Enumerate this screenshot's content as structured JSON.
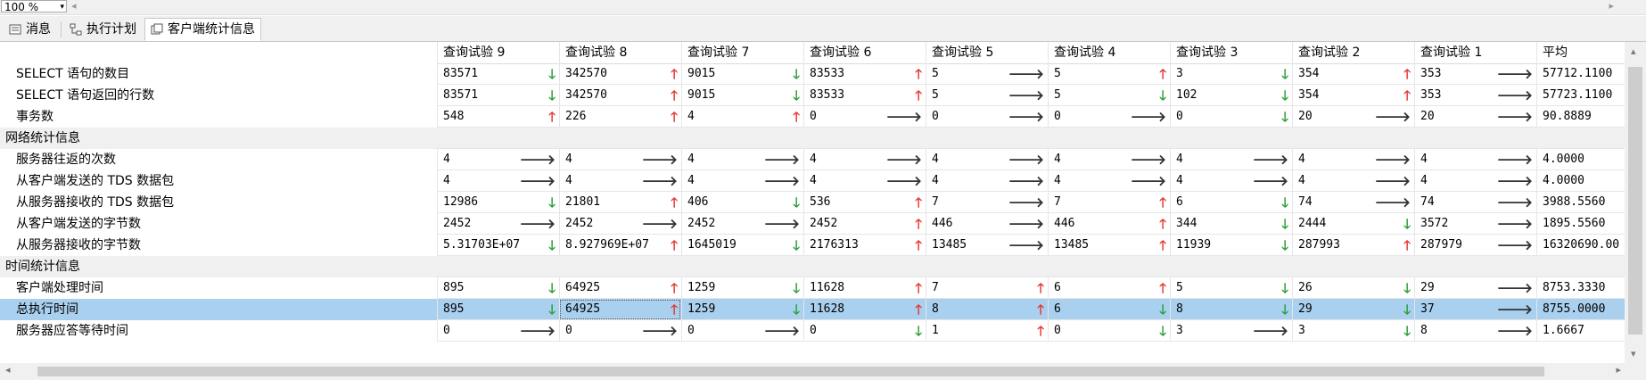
{
  "toolbar": {
    "zoom": "100 %"
  },
  "tabs": [
    {
      "label": "消息",
      "icon": "messages-icon"
    },
    {
      "label": "执行计划",
      "icon": "execution-plan-icon"
    },
    {
      "label": "客户端统计信息",
      "icon": "client-stats-icon"
    }
  ],
  "columns": [
    "查询试验 9",
    "查询试验 8",
    "查询试验 7",
    "查询试验 6",
    "查询试验 5",
    "查询试验 4",
    "查询试验 3",
    "查询试验 2",
    "查询试验 1",
    "平均"
  ],
  "rows": [
    {
      "label": "SELECT 语句的数目",
      "section": false,
      "cells": [
        [
          "83571",
          "down"
        ],
        [
          "342570",
          "up"
        ],
        [
          "9015",
          "down"
        ],
        [
          "83533",
          "up"
        ],
        [
          "5",
          "flat"
        ],
        [
          "5",
          "up"
        ],
        [
          "3",
          "down"
        ],
        [
          "354",
          "up"
        ],
        [
          "353",
          "flat"
        ]
      ],
      "avg": "57712.1100"
    },
    {
      "label": "SELECT 语句返回的行数",
      "section": false,
      "cells": [
        [
          "83571",
          "down"
        ],
        [
          "342570",
          "up"
        ],
        [
          "9015",
          "down"
        ],
        [
          "83533",
          "up"
        ],
        [
          "5",
          "flat"
        ],
        [
          "5",
          "down"
        ],
        [
          "102",
          "down"
        ],
        [
          "354",
          "up"
        ],
        [
          "353",
          "flat"
        ]
      ],
      "avg": "57723.1100"
    },
    {
      "label": "事务数",
      "section": false,
      "cells": [
        [
          "548",
          "up"
        ],
        [
          "226",
          "up"
        ],
        [
          "4",
          "up"
        ],
        [
          "0",
          "flat"
        ],
        [
          "0",
          "flat"
        ],
        [
          "0",
          "flat"
        ],
        [
          "0",
          "down"
        ],
        [
          "20",
          "flat"
        ],
        [
          "20",
          "flat"
        ]
      ],
      "avg": "90.8889"
    },
    {
      "label": "网络统计信息",
      "section": true
    },
    {
      "label": "服务器往返的次数",
      "section": false,
      "cells": [
        [
          "4",
          "flat"
        ],
        [
          "4",
          "flat"
        ],
        [
          "4",
          "flat"
        ],
        [
          "4",
          "flat"
        ],
        [
          "4",
          "flat"
        ],
        [
          "4",
          "flat"
        ],
        [
          "4",
          "flat"
        ],
        [
          "4",
          "flat"
        ],
        [
          "4",
          "flat"
        ]
      ],
      "avg": "4.0000"
    },
    {
      "label": "从客户端发送的 TDS 数据包",
      "section": false,
      "cells": [
        [
          "4",
          "flat"
        ],
        [
          "4",
          "flat"
        ],
        [
          "4",
          "flat"
        ],
        [
          "4",
          "flat"
        ],
        [
          "4",
          "flat"
        ],
        [
          "4",
          "flat"
        ],
        [
          "4",
          "flat"
        ],
        [
          "4",
          "flat"
        ],
        [
          "4",
          "flat"
        ]
      ],
      "avg": "4.0000"
    },
    {
      "label": "从服务器接收的 TDS 数据包",
      "section": false,
      "cells": [
        [
          "12986",
          "down"
        ],
        [
          "21801",
          "up"
        ],
        [
          "406",
          "down"
        ],
        [
          "536",
          "up"
        ],
        [
          "7",
          "flat"
        ],
        [
          "7",
          "up"
        ],
        [
          "6",
          "down"
        ],
        [
          "74",
          "flat"
        ],
        [
          "74",
          "flat"
        ]
      ],
      "avg": "3988.5560"
    },
    {
      "label": "从客户端发送的字节数",
      "section": false,
      "cells": [
        [
          "2452",
          "flat"
        ],
        [
          "2452",
          "flat"
        ],
        [
          "2452",
          "flat"
        ],
        [
          "2452",
          "up"
        ],
        [
          "446",
          "flat"
        ],
        [
          "446",
          "up"
        ],
        [
          "344",
          "down"
        ],
        [
          "2444",
          "down"
        ],
        [
          "3572",
          "flat"
        ]
      ],
      "avg": "1895.5560"
    },
    {
      "label": "从服务器接收的字节数",
      "section": false,
      "cells": [
        [
          "5.31703E+07",
          "down"
        ],
        [
          "8.927969E+07",
          "up"
        ],
        [
          "1645019",
          "down"
        ],
        [
          "2176313",
          "up"
        ],
        [
          "13485",
          "flat"
        ],
        [
          "13485",
          "up"
        ],
        [
          "11939",
          "down"
        ],
        [
          "287993",
          "up"
        ],
        [
          "287979",
          "flat"
        ]
      ],
      "avg": "16320690.00"
    },
    {
      "label": "时间统计信息",
      "section": true
    },
    {
      "label": "客户端处理时间",
      "section": false,
      "cells": [
        [
          "895",
          "down"
        ],
        [
          "64925",
          "up"
        ],
        [
          "1259",
          "down"
        ],
        [
          "11628",
          "up"
        ],
        [
          "7",
          "up"
        ],
        [
          "6",
          "up"
        ],
        [
          "5",
          "down"
        ],
        [
          "26",
          "down"
        ],
        [
          "29",
          "flat"
        ]
      ],
      "avg": "8753.3330"
    },
    {
      "label": "总执行时间",
      "section": false,
      "selected": true,
      "cells": [
        [
          "895",
          "down"
        ],
        [
          "64925",
          "up"
        ],
        [
          "1259",
          "down"
        ],
        [
          "11628",
          "up"
        ],
        [
          "8",
          "up"
        ],
        [
          "6",
          "down"
        ],
        [
          "8",
          "down"
        ],
        [
          "29",
          "down"
        ],
        [
          "37",
          "flat"
        ]
      ],
      "avg": "8755.0000"
    },
    {
      "label": "服务器应答等待时间",
      "section": false,
      "cells": [
        [
          "0",
          "flat"
        ],
        [
          "0",
          "flat"
        ],
        [
          "0",
          "flat"
        ],
        [
          "0",
          "down"
        ],
        [
          "1",
          "up"
        ],
        [
          "0",
          "down"
        ],
        [
          "3",
          "flat"
        ],
        [
          "3",
          "down"
        ],
        [
          "8",
          "flat"
        ]
      ],
      "avg": "1.6667"
    }
  ],
  "arrows": {
    "up": "🡑",
    "down": "🡓",
    "flat": "🡒"
  },
  "colors": {
    "up": "#e53935",
    "down": "#2e9e3a",
    "selected_row": "#aad0ef"
  }
}
